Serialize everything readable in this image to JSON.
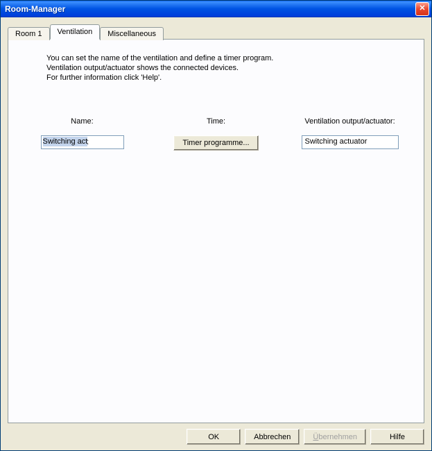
{
  "window": {
    "title": "Room-Manager"
  },
  "tabs": [
    {
      "label": "Room 1",
      "active": false
    },
    {
      "label": "Ventilation",
      "active": true
    },
    {
      "label": "Miscellaneous",
      "active": false
    }
  ],
  "description": {
    "line1": "You can set the name of the ventilation and define a timer program.",
    "line2": "Ventilation output/actuator shows the connected devices.",
    "line3": "For further information click 'Help'."
  },
  "columns": {
    "name": {
      "label": "Name:",
      "value": "Switching act"
    },
    "time": {
      "label": "Time:",
      "button": "Timer programme..."
    },
    "output": {
      "label": "Ventilation output/actuator:",
      "value": "Switching actuator"
    }
  },
  "buttons": {
    "ok": "OK",
    "cancel": "Abbrechen",
    "apply_pre": "Ü",
    "apply_rest": "bernehmen",
    "help": "Hilfe"
  }
}
